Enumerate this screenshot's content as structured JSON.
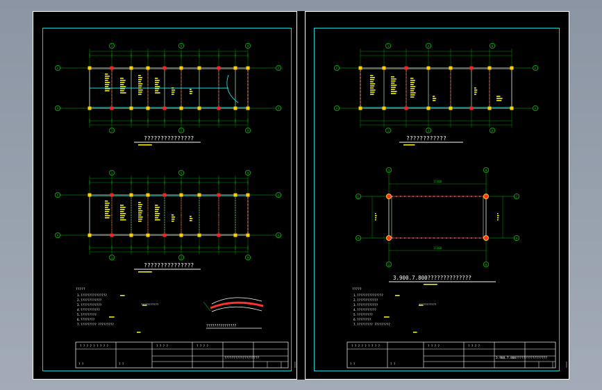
{
  "colors": {
    "background": "#000000",
    "frame": "#ffffff",
    "inner_frame": "#1ad0d0",
    "axis": "#00c000",
    "wall": "#ffffff",
    "column": "#ffd000",
    "beam_dashed": "#e02020",
    "annotation": "#f0f020",
    "cyan": "#20e0e0"
  },
  "left_sheet": {
    "plan1_title": "???????????????",
    "plan2_title": "???????????????",
    "detail_title": "???????????????",
    "notes_heading": "?????",
    "notes": [
      "1.???????????????",
      "2.????????????",
      "3.????????????",
      "4.???????????",
      "5.?????????",
      "6.????????",
      "7.????????? ?????????"
    ],
    "titleblock_project": "???????????????????"
  },
  "right_sheet": {
    "plan1_title": "????????????",
    "plan2_title": "3.900.7.800??????????????",
    "dim_top": "15300",
    "dim_side": "7500",
    "notes_heading": "?????",
    "notes": [
      "1.???????????????",
      "2.????????????",
      "3.????????????",
      "4.???????????",
      "5.?????????",
      "6.????????",
      "7.????????? ?????????"
    ],
    "titleblock_project": "3.900.7.800?????????????????"
  },
  "axis_labels": {
    "A": "A",
    "B": "B",
    "C": "C"
  }
}
